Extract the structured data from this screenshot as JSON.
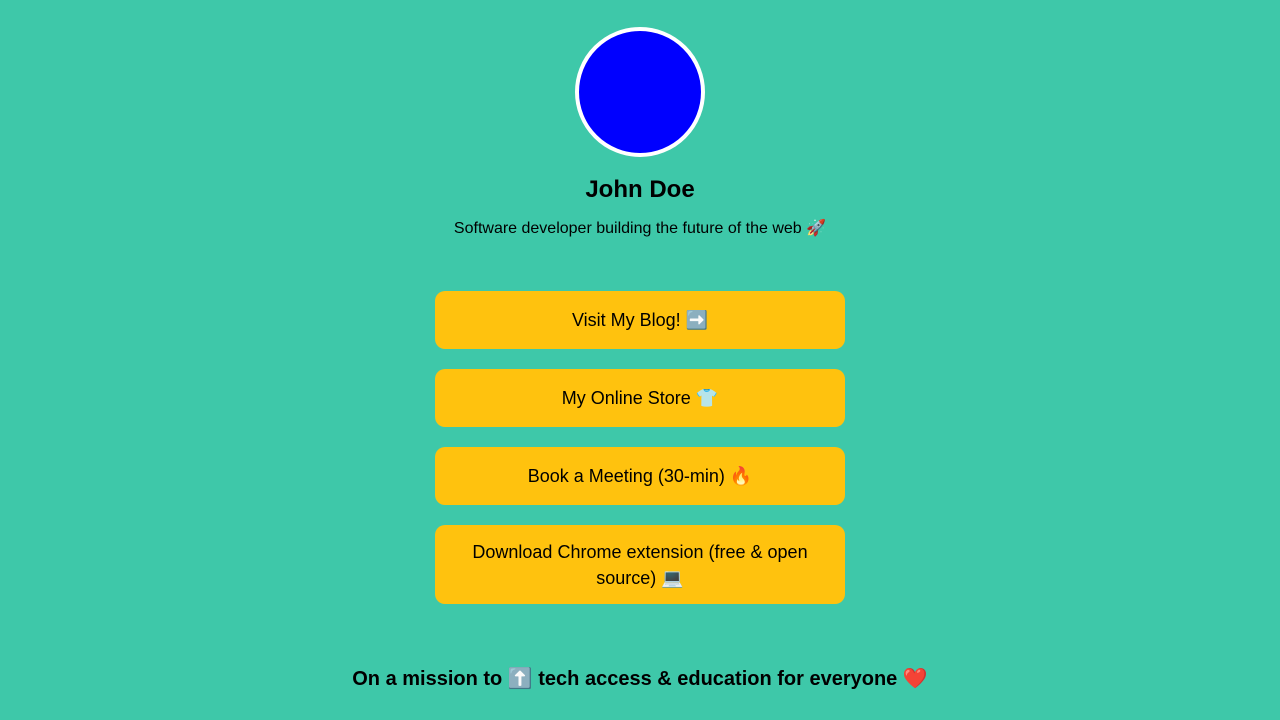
{
  "profile": {
    "avatar_color": "#0000ff",
    "name": "John Doe",
    "bio": "Software developer building the future of the web 🚀"
  },
  "links": [
    {
      "label": "Visit My Blog! ➡️"
    },
    {
      "label": "My Online Store 👕"
    },
    {
      "label": "Book a Meeting (30-min) 🔥"
    },
    {
      "label": "Download Chrome extension (free & open source) 💻"
    }
  ],
  "footer": {
    "mission": "On a mission to ⬆️ tech access & education for everyone ❤️"
  },
  "colors": {
    "background": "#3ec8a9",
    "button": "#ffc20e",
    "avatar_border": "#ffffff"
  }
}
